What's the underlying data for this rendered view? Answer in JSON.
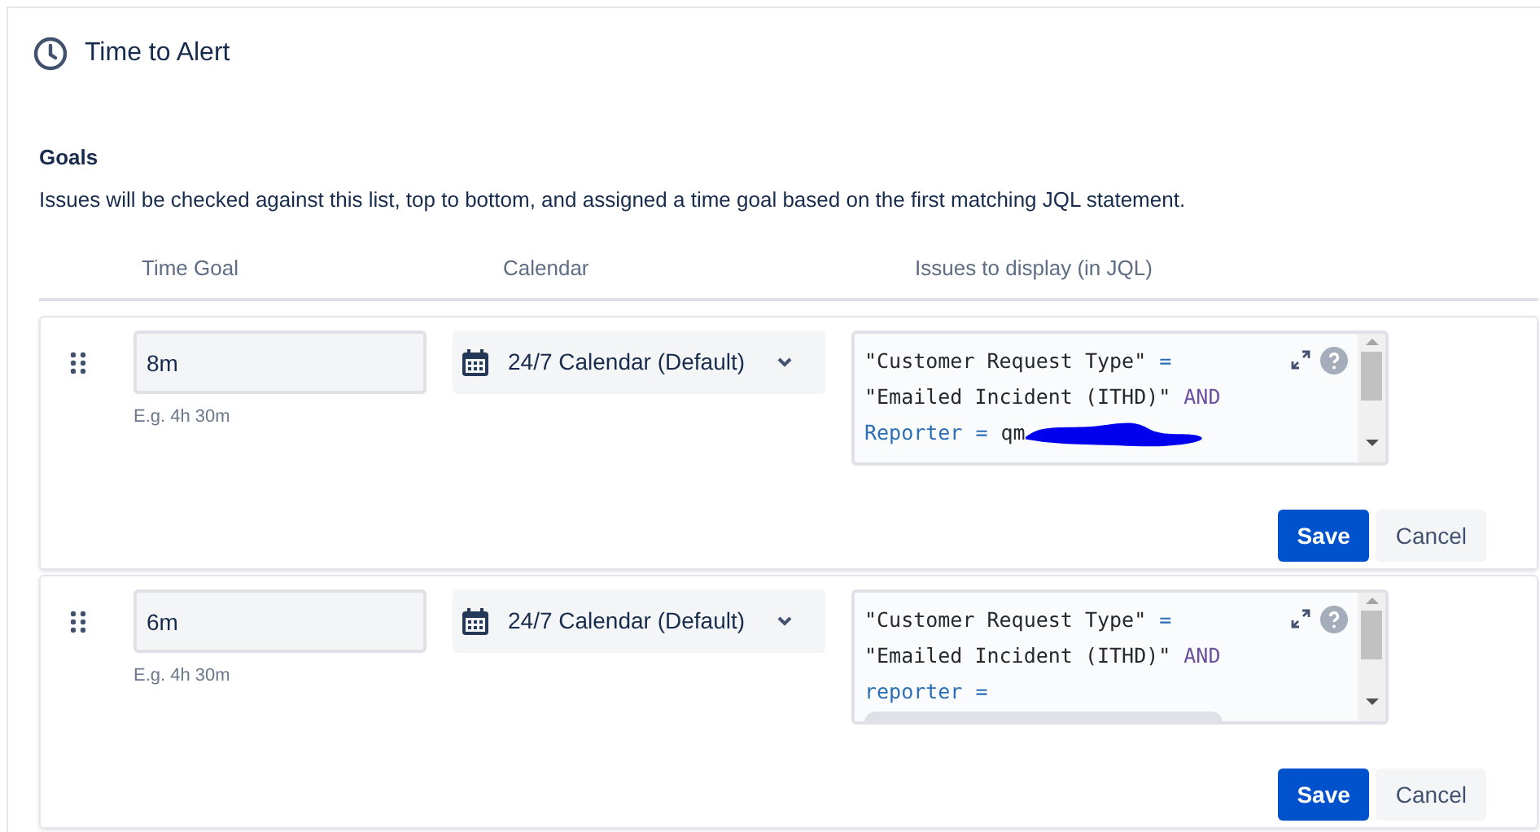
{
  "section": {
    "title": "Time to Alert"
  },
  "goals": {
    "heading": "Goals",
    "description": "Issues will be checked against this list, top to bottom, and assigned a time goal based on the first matching JQL statement."
  },
  "columns": [
    "Time Goal",
    "Calendar",
    "Issues to display (in JQL)"
  ],
  "rows": [
    {
      "time_goal": "8m",
      "hint": "E.g. 4h 30m",
      "calendar": "24/7 Calendar (Default)",
      "jql_lines": [
        [
          {
            "kind": "string",
            "text": "\"Customer Request Type\""
          },
          {
            "kind": "operator",
            "text": "="
          }
        ],
        [
          {
            "kind": "string",
            "text": "\"Emailed Incident (ITHD)\""
          },
          {
            "kind": "keyword",
            "text": "AND"
          }
        ],
        [
          {
            "kind": "field",
            "text": "Reporter"
          },
          {
            "kind": "operator",
            "text": "="
          },
          {
            "kind": "string",
            "text": "qm"
          },
          {
            "kind": "redaction"
          }
        ]
      ],
      "buttons": [
        "Save",
        "Cancel"
      ]
    },
    {
      "time_goal": "6m",
      "hint": "E.g. 4h 30m",
      "calendar": "24/7 Calendar (Default)",
      "jql_lines": [
        [
          {
            "kind": "string",
            "text": "\"Customer Request Type\""
          },
          {
            "kind": "operator",
            "text": "="
          }
        ],
        [
          {
            "kind": "string",
            "text": "\"Emailed Incident (ITHD)\""
          },
          {
            "kind": "keyword",
            "text": "AND"
          }
        ],
        [
          {
            "kind": "field",
            "text": "reporter"
          },
          {
            "kind": "operator",
            "text": "="
          }
        ],
        [
          {
            "kind": "chip"
          }
        ]
      ],
      "buttons": [
        "Save",
        "Cancel"
      ]
    }
  ]
}
